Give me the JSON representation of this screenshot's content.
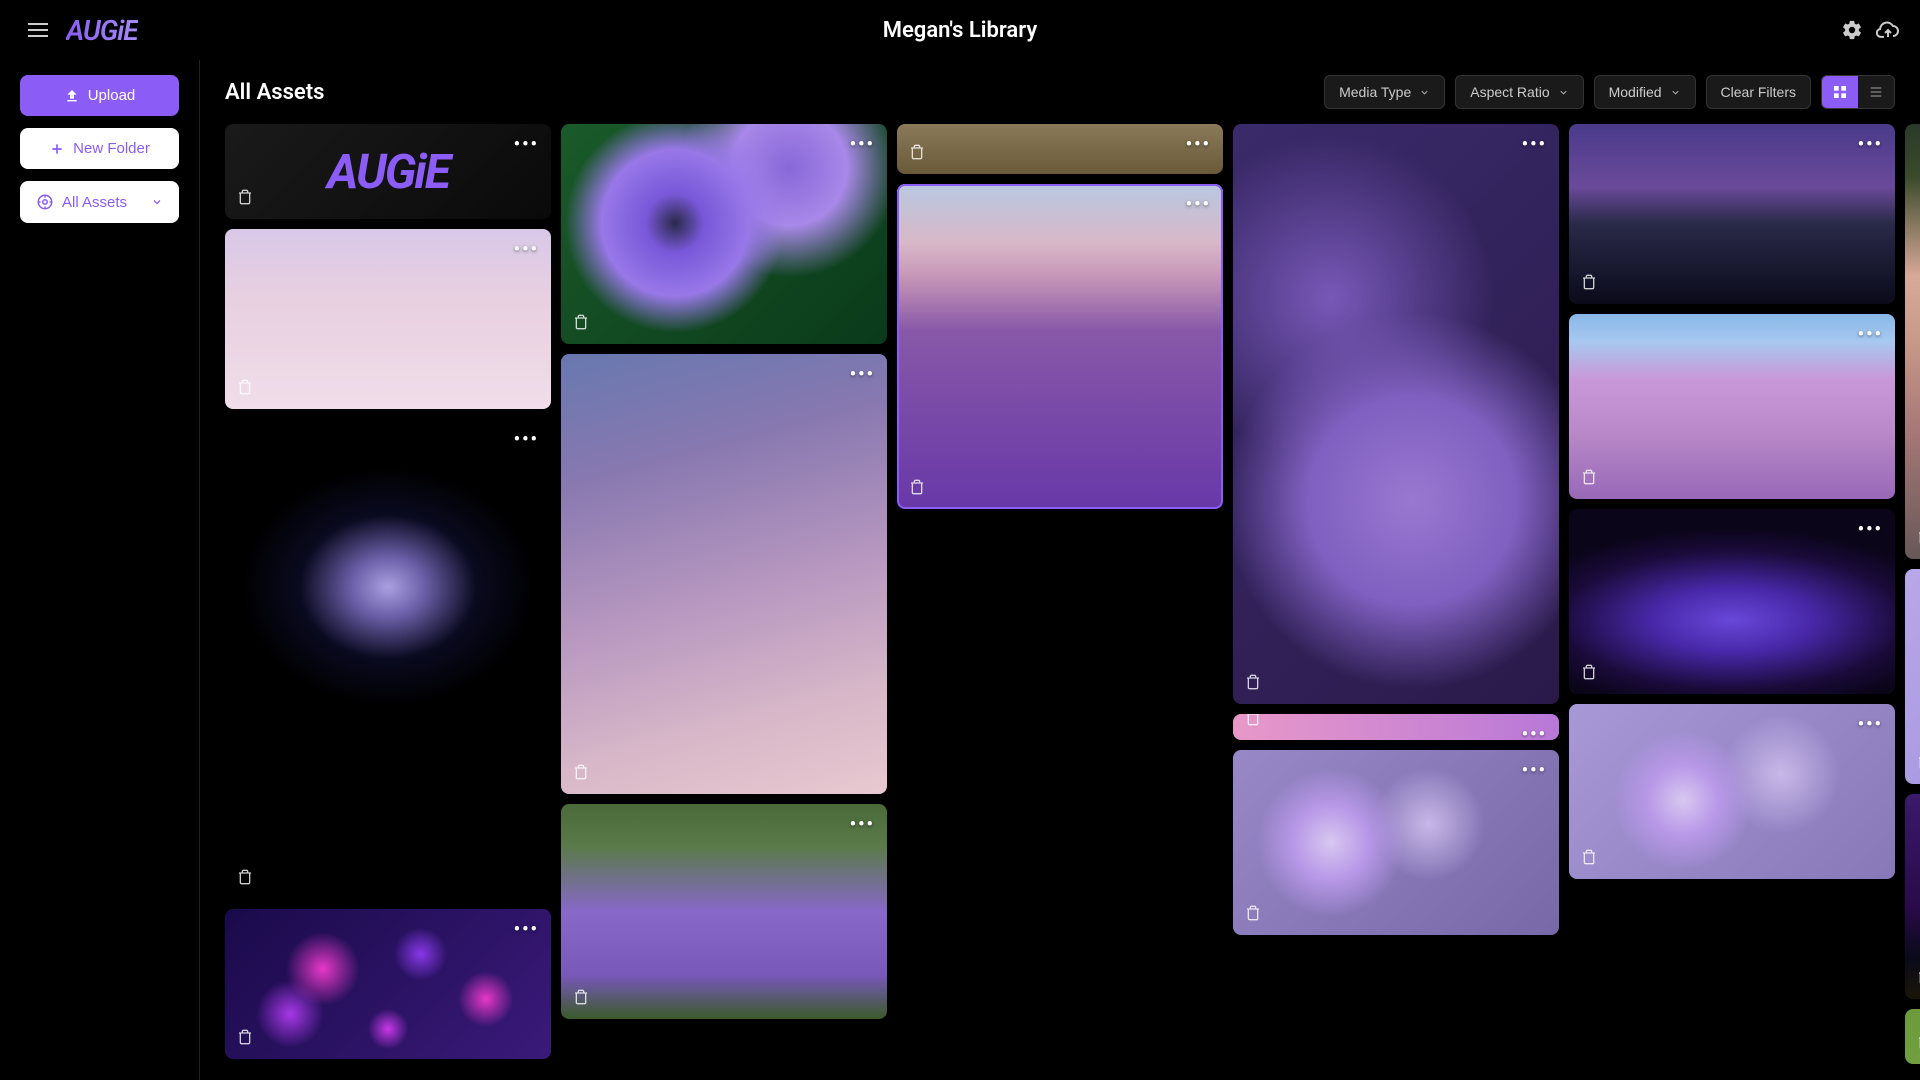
{
  "header": {
    "logo": "AUGiE",
    "title": "Megan's Library"
  },
  "sidebar": {
    "upload_label": "Upload",
    "new_folder_label": "New Folder",
    "all_assets_label": "All Assets"
  },
  "toolbar": {
    "section_title": "All Assets",
    "filters": {
      "media_type": "Media Type",
      "aspect_ratio": "Aspect Ratio",
      "modified": "Modified"
    },
    "clear_filters": "Clear Filters"
  },
  "icons": {
    "more": "•••"
  },
  "assets": {
    "col1": [
      {
        "class": "img-logo",
        "label": "AUGiE",
        "selected": false
      },
      {
        "class": "img-clouds",
        "selected": false
      },
      {
        "class": "img-jellyfish",
        "selected": false
      },
      {
        "class": "img-bokeh",
        "selected": false
      }
    ],
    "col2": [
      {
        "class": "img-anemone",
        "selected": false
      },
      {
        "class": "img-gradient-sky",
        "selected": false
      },
      {
        "class": "img-lavender-close",
        "selected": false
      },
      {
        "class": "img-grass",
        "selected": false
      }
    ],
    "col3": [
      {
        "class": "img-lavender-field",
        "selected": true
      },
      {
        "class": "img-lilac",
        "selected": false
      },
      {
        "class": "img-field2",
        "selected": false
      }
    ],
    "col4": [
      {
        "class": "img-cosmos",
        "selected": false
      },
      {
        "class": "img-mountain",
        "selected": false
      },
      {
        "class": "img-jacaranda",
        "selected": false
      },
      {
        "class": "img-mesh",
        "selected": false
      },
      {
        "class": "img-cosmos2",
        "selected": false
      }
    ],
    "col5": [
      {
        "class": "img-willow",
        "selected": false
      },
      {
        "class": "img-butterfly",
        "selected": false
      },
      {
        "class": "img-milkyway",
        "selected": false
      },
      {
        "class": "img-green",
        "selected": false
      }
    ]
  }
}
